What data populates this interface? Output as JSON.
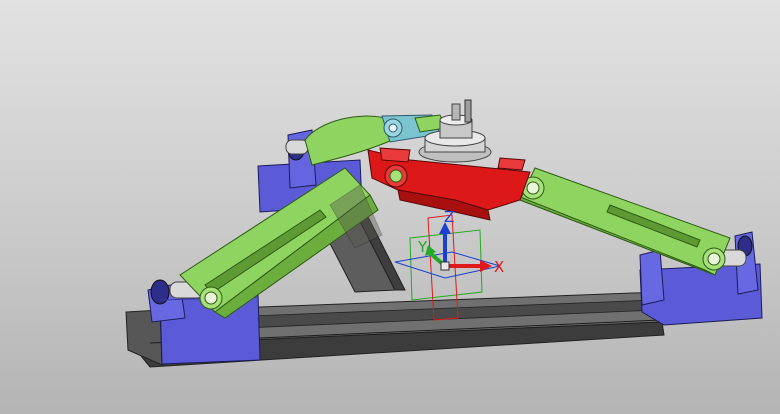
{
  "viewport": {
    "background_top": "#e2e2e2",
    "background_bottom": "#b4b4b4"
  },
  "colors": {
    "base_blue": "#5b5bd8",
    "link_green": "#8fd460",
    "platform_red": "#dd1818",
    "rail_gray": "#6c6c6c",
    "spindle_silver": "#c9c9c9",
    "x_axis": "#e01a1a",
    "y_axis": "#22aa22",
    "z_axis": "#1d3fd0"
  },
  "triad": {
    "x_label": "X",
    "y_label": "Y",
    "z_label": "Z"
  }
}
